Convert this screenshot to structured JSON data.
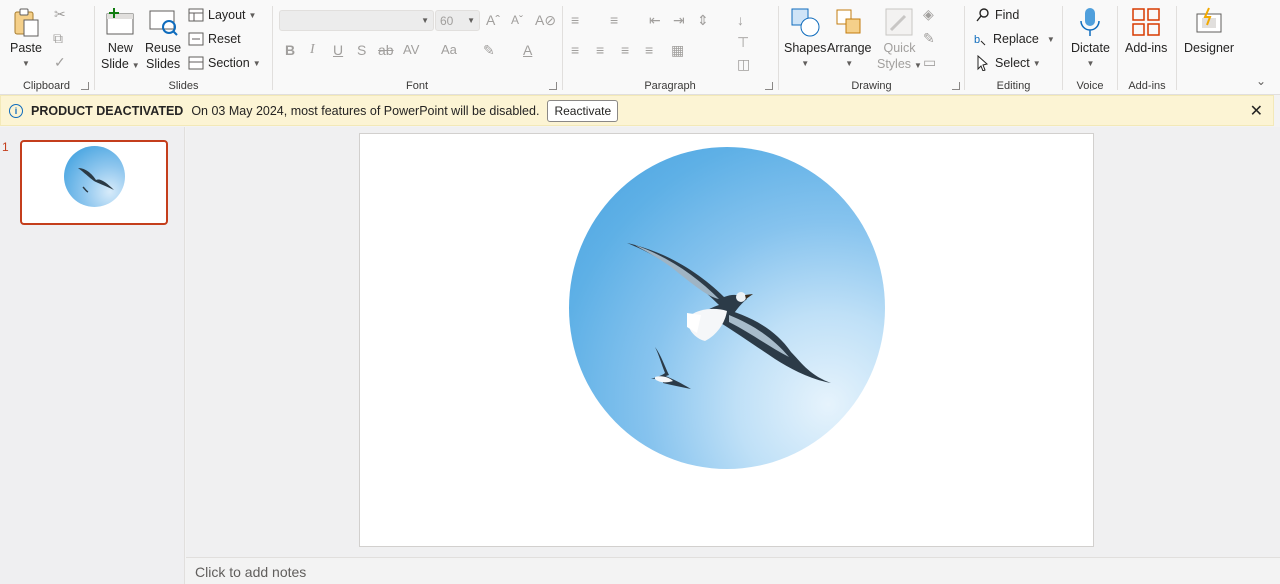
{
  "ribbon": {
    "clipboard": {
      "paste_label": "Paste",
      "group_label": "Clipboard"
    },
    "slides": {
      "new_slide_line1": "New",
      "new_slide_line2": "Slide",
      "reuse_line1": "Reuse",
      "reuse_line2": "Slides",
      "layout_label": "Layout",
      "reset_label": "Reset",
      "section_label": "Section",
      "group_label": "Slides"
    },
    "font": {
      "font_name_value": "",
      "font_size_value": "60",
      "group_label": "Font"
    },
    "paragraph": {
      "group_label": "Paragraph"
    },
    "drawing": {
      "shapes_label": "Shapes",
      "arrange_label": "Arrange",
      "quick_line1": "Quick",
      "quick_line2": "Styles",
      "group_label": "Drawing"
    },
    "editing": {
      "find_label": "Find",
      "replace_label": "Replace",
      "select_label": "Select",
      "group_label": "Editing"
    },
    "voice": {
      "dictate_label": "Dictate",
      "group_label": "Voice"
    },
    "addins": {
      "addins_label": "Add-ins",
      "group_label": "Add-ins"
    },
    "designer": {
      "designer_label": "Designer"
    }
  },
  "infobar": {
    "title": "PRODUCT DEACTIVATED",
    "message": "On 03 May 2024, most features of PowerPoint will be disabled.",
    "button_label": "Reactivate"
  },
  "thumbnails": [
    {
      "number": "1"
    }
  ],
  "notes": {
    "placeholder": "Click to add notes"
  },
  "colors": {
    "accent": "#c43e1c",
    "infobar_bg": "#fcf4d4",
    "sky": "#5eb0e6"
  }
}
